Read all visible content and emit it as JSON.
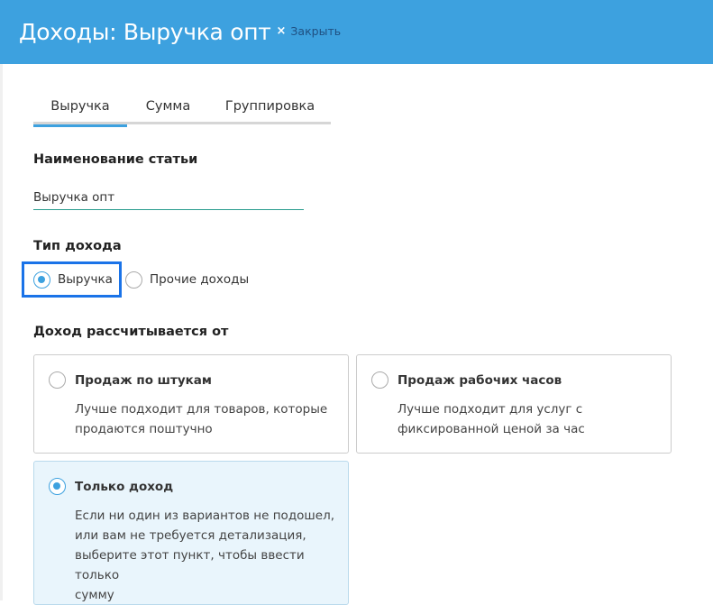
{
  "header": {
    "title": "Доходы: Выручка опт",
    "close_icon": "×",
    "close_label": "Закрыть"
  },
  "tabs": [
    {
      "label": "Выручка",
      "active": true
    },
    {
      "label": "Сумма",
      "active": false
    },
    {
      "label": "Группировка",
      "active": false
    }
  ],
  "name_section": {
    "label": "Наименование статьи",
    "value": "Выручка опт"
  },
  "income_type": {
    "label": "Тип дохода",
    "options": [
      {
        "label": "Выручка",
        "checked": true
      },
      {
        "label": "Прочие доходы",
        "checked": false
      }
    ]
  },
  "calc_section": {
    "label": "Доход рассчитывается от",
    "cards": [
      {
        "title": "Продаж по штукам",
        "desc": [
          "Лучше подходит для товаров, которые",
          "продаются поштучно"
        ],
        "checked": false
      },
      {
        "title": "Продаж рабочих часов",
        "desc": [
          "Лучше подходит для услуг с",
          "фиксированной ценой за час"
        ],
        "checked": false
      },
      {
        "title": "Только доход",
        "desc": [
          "Если ни один из вариантов не подошел,",
          "или вам не требуется детализация,",
          "выберите этот пункт, чтобы ввести только",
          "сумму"
        ],
        "checked": true
      }
    ]
  },
  "colors": {
    "accent": "#3da1df",
    "focus_outline": "#1a73e8",
    "selected_card_bg": "#e9f5fc",
    "input_underline": "#2a9d8f"
  }
}
